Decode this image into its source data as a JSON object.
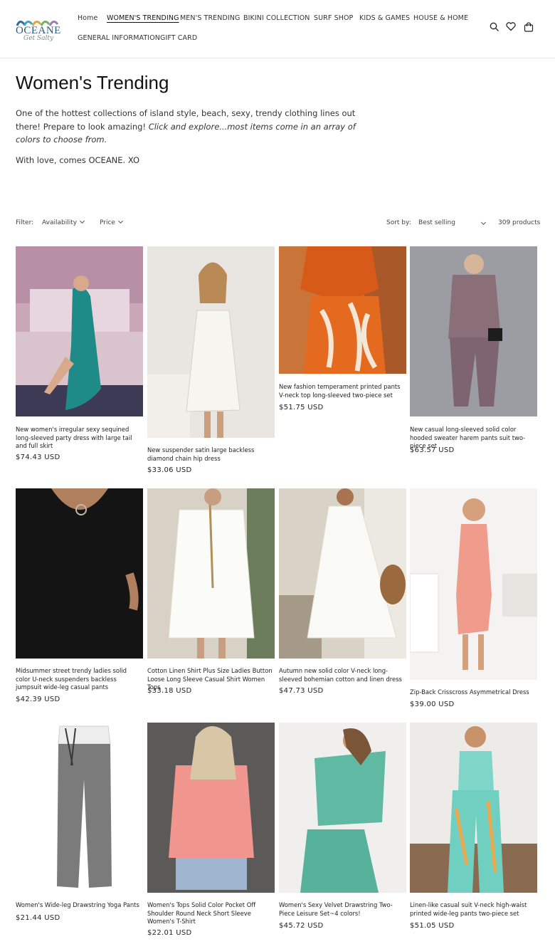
{
  "header": {
    "logo": {
      "name": "OCEANE",
      "tagline": "Get Salty"
    },
    "nav": [
      {
        "label": "Home"
      },
      {
        "label": "WOMEN'S TRENDING"
      },
      {
        "label": "MEN'S TRENDING"
      },
      {
        "label": "BIKINI COLLECTION"
      },
      {
        "label": "SURF SHOP"
      },
      {
        "label": "KIDS & GAMES"
      },
      {
        "label": "HOUSE & HOME"
      },
      {
        "label": "GENERAL INFORMATION"
      },
      {
        "label": "GIFT CARD"
      }
    ],
    "icons": [
      "search-icon",
      "heart-icon",
      "cart-icon"
    ]
  },
  "collection": {
    "title": "Women's Trending",
    "description_plain": "One of the hottest collections of island style, beach, sexy, trendy clothing lines out there! Prepare to look amazing!",
    "description_italic": "Click and explore...most items come in an array of colors to choose from.",
    "signoff": "With love, comes OCEANE. XO"
  },
  "filters": {
    "filter_label": "Filter:",
    "availability": "Availability",
    "price": "Price",
    "sort_label": "Sort by:",
    "sort_value": "Best selling",
    "count": "309 products"
  },
  "products": [
    {
      "title": "New women's irregular sexy sequined long-sleeved party dress with large tail and full skirt",
      "price": "$74.43 USD"
    },
    {
      "title": "New suspender satin large backless diamond chain hip dress",
      "price": "$33.06 USD"
    },
    {
      "title": "New fashion temperament printed pants V-neck top long-sleeved two-piece set",
      "price": "$51.75 USD"
    },
    {
      "title": "New casual long-sleeved solid color hooded sweater harem pants suit two-piece set",
      "price": "$63.57 USD"
    },
    {
      "title": "Midsummer street trendy ladies solid color U-neck suspenders backless jumpsuit wide-leg casual pants",
      "price": "$42.39 USD"
    },
    {
      "title": "Cotton Linen Shirt Plus Size Ladies Button Loose Long Sleeve Casual Shirt Women Tops",
      "price": "$33.18 USD"
    },
    {
      "title": "Autumn new solid color V-neck long-sleeved bohemian cotton and linen dress",
      "price": "$47.73 USD"
    },
    {
      "title": "Zip-Back Crisscross Asymmetrical Dress",
      "price": "$39.00 USD"
    },
    {
      "title": "Women's Wide-leg Drawstring Yoga Pants",
      "price": "$21.44 USD"
    },
    {
      "title": "Women's Tops Solid Color Pocket Off Shoulder Round Neck Short Sleeve Women's T-Shirt",
      "price": "$22.01 USD"
    },
    {
      "title": "Women's Sexy Velvet Drawstring Two-Piece Leisure Set~4 colors!",
      "price": "$45.72 USD"
    },
    {
      "title": "Linen-like casual suit V-neck high-waist printed wide-leg pants two-piece set",
      "price": "$51.05 USD"
    }
  ],
  "colors": {
    "text": "#222222",
    "border": "#e4e4e4",
    "logo_blue": "#2b5a7a"
  }
}
